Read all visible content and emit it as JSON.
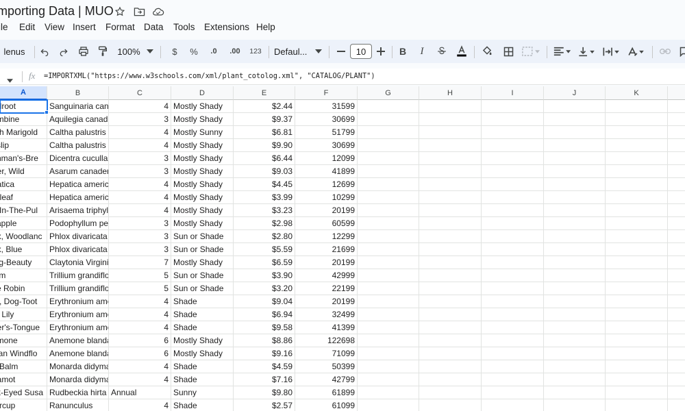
{
  "app": {
    "doc_title": "Importing Data | MUO"
  },
  "title_icons": [
    "star-icon",
    "move-to-folder-icon",
    "cloud-status-icon"
  ],
  "menu": [
    "ile",
    "Edit",
    "View",
    "Insert",
    "Format",
    "Data",
    "Tools",
    "Extensions",
    "Help"
  ],
  "toolbar": {
    "menus_label": "lenus",
    "zoom": "100%",
    "currency": "$",
    "percent": "%",
    "decrease_decimal": ".0",
    "increase_decimal": ".00",
    "number_format": "123",
    "font": "Defaul...",
    "font_size": "10",
    "bold": "B",
    "italic": "I"
  },
  "formula_bar": {
    "fx": "fx",
    "formula": "=IMPORTXML(\"https://www.w3schools.com/xml/plant_cotolog.xml\", \"CATALOG/PLANT\")"
  },
  "columns": [
    "A",
    "B",
    "C",
    "D",
    "E",
    "F",
    "G",
    "H",
    "I",
    "J",
    "K"
  ],
  "rows": [
    [
      "odroot",
      "Sanguinaria can",
      "4",
      "Mostly Shady",
      "$2.44",
      "31599"
    ],
    [
      "umbine",
      "Aquilegia canad",
      "3",
      "Mostly Shady",
      "$9.37",
      "30699"
    ],
    [
      "rsh Marigold",
      "Caltha palustris",
      "4",
      "Mostly Sunny",
      "$6.81",
      "51799"
    ],
    [
      "vslip",
      "Caltha palustris",
      "4",
      "Mostly Shady",
      "$9.90",
      "30699"
    ],
    [
      "chman's-Bre",
      "Dicentra cucullar",
      "3",
      "Mostly Shady",
      "$6.44",
      "12099"
    ],
    [
      "ger, Wild",
      "Asarum canader",
      "3",
      "Mostly Shady",
      "$9.03",
      "41899"
    ],
    [
      "patica",
      "Hepatica americ",
      "4",
      "Mostly Shady",
      "$4.45",
      "12699"
    ],
    [
      "erleaf",
      "Hepatica americ",
      "4",
      "Mostly Shady",
      "$3.99",
      "10299"
    ],
    [
      "k-In-The-Pul",
      "Arisaema triphyll",
      "4",
      "Mostly Shady",
      "$3.23",
      "20199"
    ],
    [
      "yapple",
      "Podophyllum pel",
      "3",
      "Mostly Shady",
      "$2.98",
      "60599"
    ],
    [
      "ox, Woodlanc",
      "Phlox divaricata",
      "3",
      "Sun or Shade",
      "$2.80",
      "12299"
    ],
    [
      "ox, Blue",
      "Phlox divaricata",
      "3",
      "Sun or Shade",
      "$5.59",
      "21699"
    ],
    [
      "ing-Beauty",
      "Claytonia Virgini",
      "7",
      "Mostly Shady",
      "$6.59",
      "20199"
    ],
    [
      "ium",
      "Trillium grandiflo",
      "5",
      "Sun or Shade",
      "$3.90",
      "42999"
    ],
    [
      "ke Robin",
      "Trillium grandiflo",
      "5",
      "Sun or Shade",
      "$3.20",
      "22199"
    ],
    [
      "et, Dog-Toot",
      "Erythronium ame",
      "4",
      "Shade",
      "$9.04",
      "20199"
    ],
    [
      "ut Lily",
      "Erythronium ame",
      "4",
      "Shade",
      "$6.94",
      "32499"
    ],
    [
      "der's-Tongue",
      "Erythronium ame",
      "4",
      "Shade",
      "$9.58",
      "41399"
    ],
    [
      "emone",
      "Anemone blanda",
      "6",
      "Mostly Shady",
      "$8.86",
      "122698"
    ],
    [
      "cian Windflo",
      "Anemone blanda",
      "6",
      "Mostly Shady",
      "$9.16",
      "71099"
    ],
    [
      "e Balm",
      "Monarda didyma",
      "4",
      "Shade",
      "$4.59",
      "50399"
    ],
    [
      "gamot",
      "Monarda didyma",
      "4",
      "Shade",
      "$7.16",
      "42799"
    ],
    [
      "ck-Eyed Susa",
      "Rudbeckia hirta",
      "Annual",
      "Sunny",
      "$9.80",
      "61899"
    ],
    [
      "tercup",
      "Ranunculus",
      "4",
      "Shade",
      "$2.57",
      "61099"
    ]
  ],
  "colors": {
    "accent": "#1a73e8",
    "toolbar_bg": "#edf2fa",
    "selected_header": "#d3e3fd"
  }
}
